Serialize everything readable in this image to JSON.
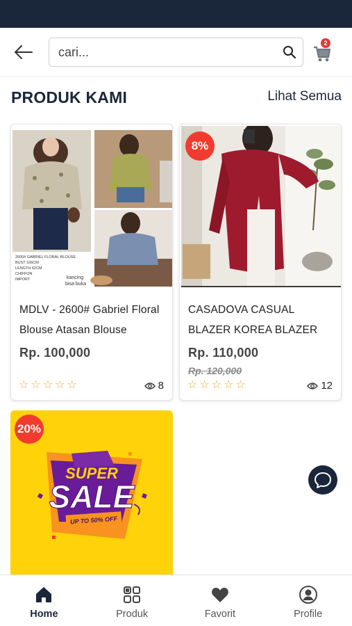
{
  "header": {
    "search_placeholder": "cari...",
    "cart_count": "2"
  },
  "section": {
    "title": "PRODUK KAMI",
    "see_all": "Lihat Semua"
  },
  "products": [
    {
      "name": "MDLV - 2600# Gabriel Floral Blouse Atasan Blouse",
      "price": "Rp. 100,000",
      "old_price": "",
      "views": "8",
      "rating": 0,
      "image_text": {
        "line1": "2600# GABRIEL FLORAL BLOUSE",
        "line2": "BUST 106CM",
        "line3": "LENGTH 62CM",
        "line4": "CHIFFON",
        "line5": "IMPORT",
        "caption1": "kancing",
        "caption2": "bisa buka"
      }
    },
    {
      "name": "CASADOVA CASUAL BLAZER KOREA BLAZER",
      "price": "Rp. 110,000",
      "old_price": "Rp. 120,000",
      "discount": "8%",
      "views": "12",
      "rating": 0
    },
    {
      "discount": "20%",
      "image_text": {
        "super": "SUPER",
        "sale": "SALE",
        "upto": "UP TO 50% OFF"
      }
    }
  ],
  "nav": [
    {
      "label": "Home",
      "icon": "home-icon",
      "active": true
    },
    {
      "label": "Produk",
      "icon": "grid-icon",
      "active": false
    },
    {
      "label": "Favorit",
      "icon": "heart-icon",
      "active": false
    },
    {
      "label": "Profile",
      "icon": "user-circle-icon",
      "active": false
    }
  ],
  "colors": {
    "primary": "#1a2639",
    "discount": "#f03b2e",
    "star": "#f5a623",
    "sale_bg": "#ffd20a"
  }
}
